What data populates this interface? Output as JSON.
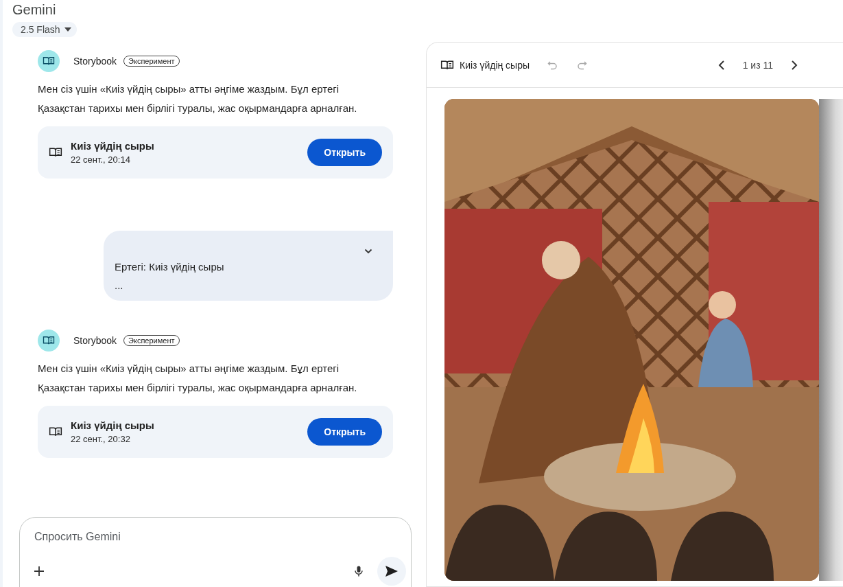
{
  "header": {
    "title": "Gemini",
    "model": "2.5 Flash"
  },
  "messages": [
    {
      "kind": "bot",
      "sender": "Storybook",
      "badge": "Эксперимент",
      "text": "Мен сіз үшін «Киіз үйдің сыры» атты әңгіме жаздым. Бұл ертегі Қазақстан тарихы мен бірлігі туралы, жас оқырмандарға арналған.",
      "card": {
        "title": "Киіз үйдің сыры",
        "date": "22 сент., 20:14",
        "button": "Открыть"
      }
    },
    {
      "kind": "user",
      "text": "Ертегі: Киіз үйдің сыры",
      "more": "...",
      "expanded": false
    },
    {
      "kind": "bot",
      "sender": "Storybook",
      "badge": "Эксперимент",
      "text": "Мен сіз үшін «Киіз үйдің сыры» атты әңгіме жаздым. Бұл ертегі Қазақстан тарихы мен бірлігі туралы, жас оқырмандарға арналған.",
      "card": {
        "title": "Киіз үйдің сыры",
        "date": "22 сент., 20:32",
        "button": "Открыть"
      }
    }
  ],
  "input": {
    "placeholder": "Спросить Gemini"
  },
  "viewer": {
    "title": "Киіз үйдің сыры",
    "undo_disabled": true,
    "redo_disabled": true,
    "page": "1 из 11"
  }
}
